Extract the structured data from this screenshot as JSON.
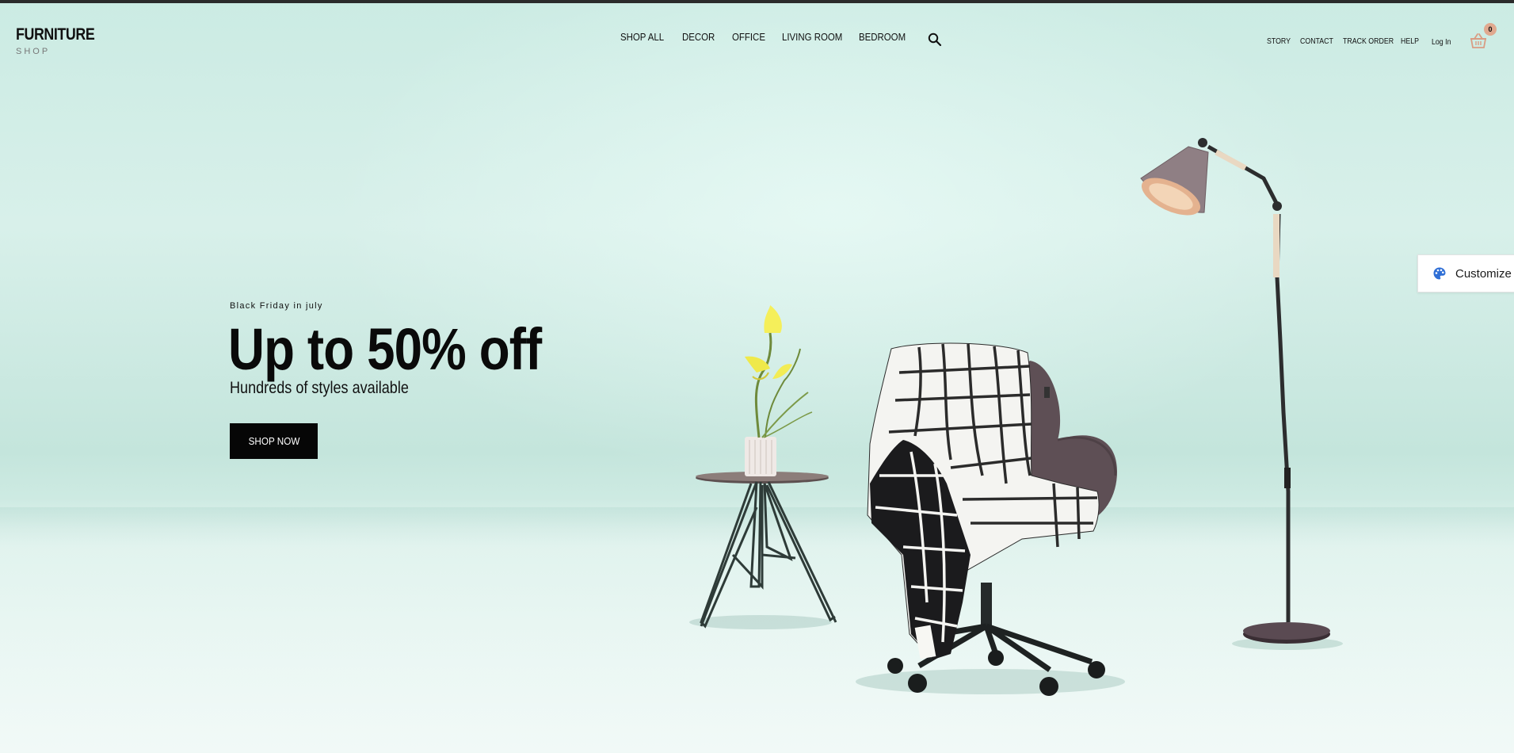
{
  "header": {
    "logo_main": "FURNITURE",
    "logo_sub": "SHOP",
    "main_nav": [
      "SHOP ALL",
      "DECOR",
      "OFFICE",
      "LIVING ROOM",
      "BEDROOM"
    ],
    "search_icon": "search-icon",
    "utility_nav": [
      "STORY",
      "CONTACT",
      "TRACK ORDER",
      "HELP",
      "Log In"
    ],
    "cart_icon": "basket-icon",
    "cart_count": "0"
  },
  "hero": {
    "eyebrow": "Black Friday in july",
    "title": "Up to 50% off",
    "subtitle": "Hundreds of styles available",
    "cta_label": "SHOP NOW"
  },
  "customize": {
    "icon": "palette-icon",
    "label": "Customize"
  },
  "colors": {
    "background": "#cbebe3",
    "text": "#111111",
    "button": "#060606",
    "cart_accent": "#e0a98f",
    "customize_icon": "#2f6fd6"
  }
}
